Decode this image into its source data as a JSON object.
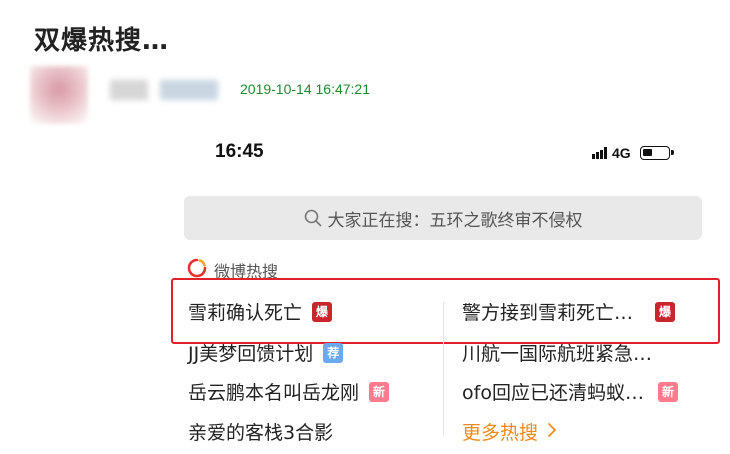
{
  "post": {
    "title": "双爆热搜…",
    "timestamp": "2019-10-14 16:47:21"
  },
  "phone": {
    "time": "16:45",
    "network": "4G"
  },
  "search": {
    "placeholder": "大家正在搜：五环之歌终审不侵权"
  },
  "hot_section": {
    "label": "微博热搜",
    "items": [
      {
        "text": "雪莉确认死亡",
        "badge": "爆"
      },
      {
        "text": "警方接到雪莉死亡…",
        "badge": "爆"
      },
      {
        "text": "JJ美梦回馈计划",
        "badge": "荐"
      },
      {
        "text": "川航一国际航班紧急…",
        "badge": ""
      },
      {
        "text": "岳云鹏本名叫岳龙刚",
        "badge": "新"
      },
      {
        "text": "ofo回应已还清蚂蚁…",
        "badge": "新"
      },
      {
        "text": "亲爱的客栈3合影",
        "badge": ""
      }
    ],
    "more_label": "更多热搜"
  },
  "colors": {
    "highlight_border": "#e0202a",
    "badge_bao": "#c8262d",
    "badge_jian": "#6aa8f0",
    "badge_xin": "#ff7a8c",
    "timestamp": "#1f8a2e",
    "more_link": "#f08a1a"
  }
}
